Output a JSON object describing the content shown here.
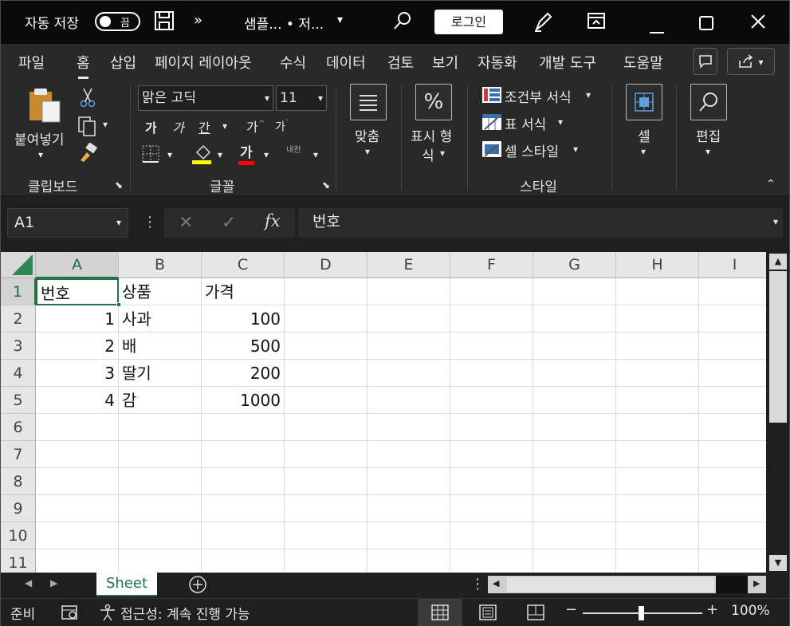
{
  "titlebar": {
    "autosave_label": "자동 저장",
    "autosave_state": "끔",
    "title": "샘플...  •  저...",
    "login_button": "로그인",
    "save_icon": "save-icon",
    "more_icon": "chevron-double-right-icon"
  },
  "menu": {
    "tabs": [
      "파일",
      "홈",
      "삽입",
      "페이지 레이아웃",
      "수식",
      "데이터",
      "검토",
      "보기",
      "자동화",
      "개발 도구",
      "도움말"
    ],
    "active": "홈"
  },
  "ribbon": {
    "clipboard": {
      "paste": "붙여넣기",
      "label": "클립보드"
    },
    "font": {
      "name": "맑은 고딕",
      "size": "11",
      "bold": "가",
      "italic": "가",
      "underline": "간",
      "grow": "가",
      "shrink": "가",
      "phonetic": "내천",
      "label": "글꼴",
      "highlight_color": "#ffff00",
      "font_color": "#ff0000"
    },
    "alignment": {
      "label": "맞춤"
    },
    "number": {
      "label_line1": "표시 형",
      "label_line2": "식",
      "icon_text": "%"
    },
    "styles": {
      "conditional": "조건부 서식",
      "table": "표 서식",
      "cell_styles": "셀 스타일",
      "label": "스타일"
    },
    "cells": {
      "label": "셀"
    },
    "editing": {
      "label": "편집"
    }
  },
  "formula_bar": {
    "name_box": "A1",
    "fx": "fx",
    "content": "번호"
  },
  "sheet": {
    "columns": [
      "A",
      "B",
      "C",
      "D",
      "E",
      "F",
      "G",
      "H",
      "I"
    ],
    "rows": [
      "1",
      "2",
      "3",
      "4",
      "5",
      "6",
      "7",
      "8",
      "9",
      "10",
      "11"
    ],
    "selected_cell": "A1",
    "header": [
      "번호",
      "상품",
      "가격"
    ],
    "data": [
      [
        "1",
        "사과",
        "100"
      ],
      [
        "2",
        "배",
        "500"
      ],
      [
        "3",
        "딸기",
        "200"
      ],
      [
        "4",
        "감",
        "1000"
      ]
    ],
    "tab_name": "Sheet"
  },
  "status": {
    "ready": "준비",
    "accessibility": "접근성: 계속 진행 가능",
    "zoom": "100%",
    "accent": "#217346"
  }
}
